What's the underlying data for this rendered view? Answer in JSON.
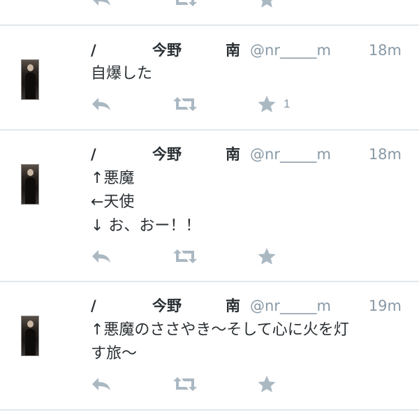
{
  "top_action_icons": [
    "reply-icon",
    "retweet-icon",
    "favorite-icon"
  ],
  "tweets": [
    {
      "name_part1": "/",
      "name_part2": "今野",
      "name_part3": "南",
      "handle": "@nr_____m",
      "time": "18m",
      "text": "自爆した",
      "favorite_count": "1"
    },
    {
      "name_part1": "/",
      "name_part2": "今野",
      "name_part3": "南",
      "handle": "@nr_____m",
      "time": "18m",
      "text": "↑悪魔\n←天使\n↓ お、おー！！",
      "favorite_count": ""
    },
    {
      "name_part1": "/",
      "name_part2": "今野",
      "name_part3": "南",
      "handle": "@nr_____m",
      "time": "19m",
      "text": "↑悪魔のささやき〜そして心に火を灯\nす旅〜",
      "favorite_count": ""
    }
  ],
  "colors": {
    "action_gray": "#aab8c2",
    "secondary_text": "#8899a6",
    "primary_text": "#292f33",
    "divider": "#e1e8ed"
  }
}
